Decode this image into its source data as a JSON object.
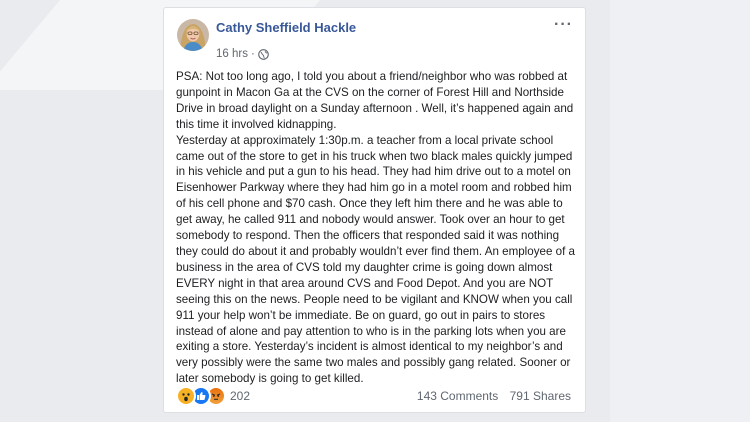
{
  "post": {
    "author": "Cathy Sheffield Hackle",
    "time": "16 hrs",
    "separator": "·",
    "more_label": "···",
    "paragraphs": [
      "PSA: Not too long ago, I told you about a friend/neighbor who was robbed at gunpoint in Macon Ga at the CVS on the corner of Forest Hill and Northside Drive in broad daylight on a Sunday afternoon . Well, it’s happened again and this time it involved kidnapping.",
      "Yesterday at approximately 1:30p.m. a teacher from a local private school came out of the store to get in his truck when two black males quickly jumped in his vehicle and put a gun to his head. They had him drive out to a motel on Eisenhower Parkway where they had him go in a motel room and robbed him of his cell phone and $70 cash. Once they left him there and he was able to get away, he called 911 and nobody would answer. Took over an hour to get somebody to respond. Then the officers that responded said it was nothing they could do about it and probably wouldn’t ever find them. An employee of a business in the area of CVS told my daughter crime is going down almost EVERY night in that area around CVS and Food Depot. And you are NOT seeing this on the news. People need to be vigilant and KNOW when you call 911 your help won’t be immediate. Be on guard, go out in pairs to stores instead of alone and pay attention to who is in the parking lots when you are exiting a store. Yesterday’s incident is almost identical to my neighbor’s and very possibly were the same two males and possibly gang related. Sooner or later somebody is going to get killed."
    ],
    "reactions": {
      "icons": [
        "wow-icon",
        "like-icon",
        "angry-icon"
      ],
      "count": "202"
    },
    "comments": "143 Comments",
    "shares": "791 Shares"
  },
  "colors": {
    "author": "#385898",
    "like": "#1877f2",
    "wow": "#f7b125",
    "angry": "#e9710f"
  }
}
